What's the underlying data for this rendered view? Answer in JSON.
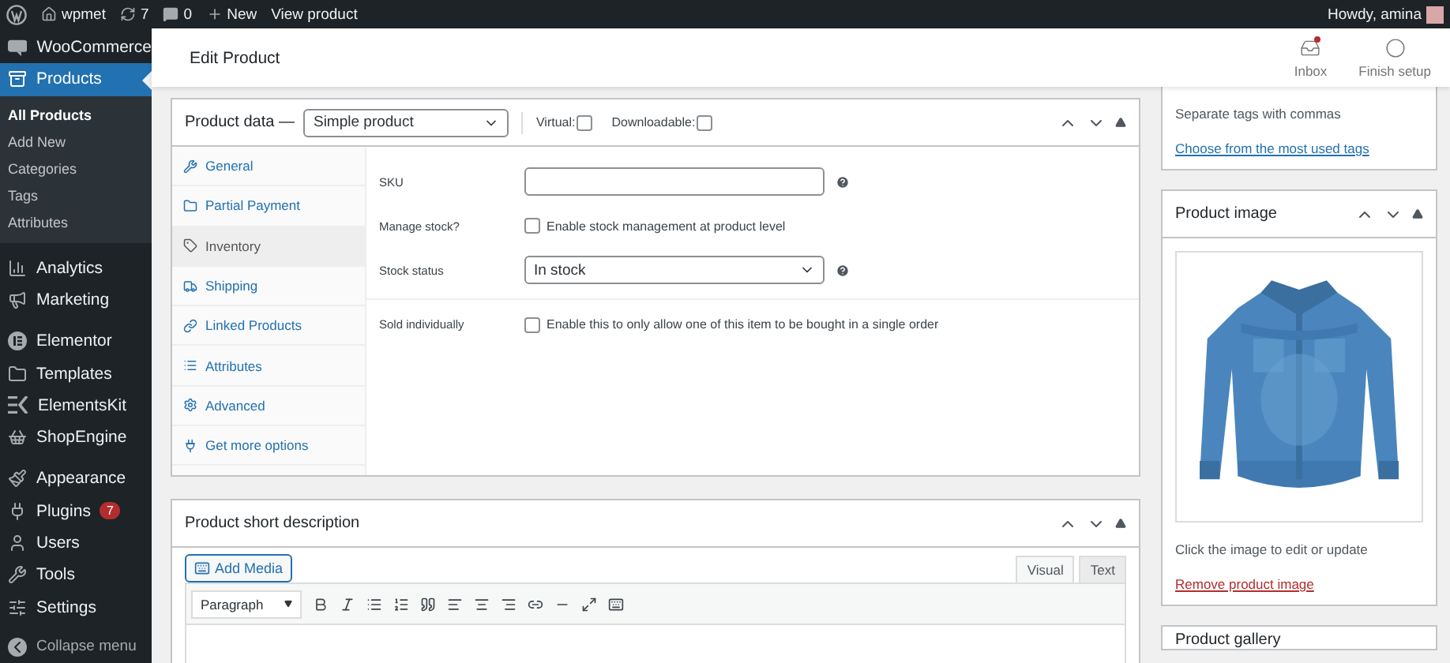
{
  "admin_bar": {
    "site": "wpmet",
    "updates": "7",
    "comments": "0",
    "new": "New",
    "view": "View product",
    "greeting": "Howdy, amina"
  },
  "sidebar": {
    "items": [
      {
        "label": "WooCommerce",
        "selected": false
      },
      {
        "label": "Products",
        "selected": true,
        "children": [
          {
            "label": "All Products",
            "selected": true
          },
          {
            "label": "Add New",
            "selected": false
          },
          {
            "label": "Categories",
            "selected": false
          },
          {
            "label": "Tags",
            "selected": false
          },
          {
            "label": "Attributes",
            "selected": false
          }
        ]
      },
      {
        "label": "Analytics",
        "selected": false
      },
      {
        "label": "Marketing",
        "selected": false
      },
      {
        "label": "Elementor",
        "selected": false
      },
      {
        "label": "Templates",
        "selected": false
      },
      {
        "label": "ElementsKit",
        "selected": false
      },
      {
        "label": "ShopEngine",
        "selected": false
      },
      {
        "label": "Appearance",
        "selected": false
      },
      {
        "label": "Plugins",
        "selected": false,
        "badge": "7"
      },
      {
        "label": "Users",
        "selected": false
      },
      {
        "label": "Tools",
        "selected": false
      },
      {
        "label": "Settings",
        "selected": false
      }
    ],
    "collapse": "Collapse menu"
  },
  "header": {
    "title": "Edit Product",
    "actions": [
      {
        "label": "Inbox",
        "unread": true
      },
      {
        "label": "Finish setup"
      }
    ]
  },
  "product_data": {
    "title": "Product data —",
    "type": "Simple product",
    "options": [
      {
        "label": "Virtual:",
        "checked": false
      },
      {
        "label": "Downloadable:",
        "checked": false
      }
    ],
    "tabs": [
      {
        "label": "General",
        "selected": false
      },
      {
        "label": "Partial Payment",
        "selected": false
      },
      {
        "label": "Inventory",
        "selected": true
      },
      {
        "label": "Shipping",
        "selected": false
      },
      {
        "label": "Linked Products",
        "selected": false
      },
      {
        "label": "Attributes",
        "selected": false
      },
      {
        "label": "Advanced",
        "selected": false
      },
      {
        "label": "Get more options",
        "selected": false
      }
    ],
    "fields": [
      {
        "kind": "text",
        "label": "SKU",
        "help": true
      },
      {
        "kind": "checkbox",
        "label": "Manage stock?",
        "text": "Enable stock management at product level",
        "checked": false
      },
      {
        "kind": "select",
        "label": "Stock status",
        "value": "In stock",
        "help": true
      },
      {
        "kind": "checkbox",
        "label": "Sold individually",
        "text": "Enable this to only allow one of this item to be bought in a single order",
        "checked": false
      }
    ]
  },
  "short_description": {
    "title": "Product short description",
    "add_media": "Add Media",
    "editor_tabs": [
      {
        "label": "Visual",
        "selected": true
      },
      {
        "label": "Text",
        "selected": false
      }
    ],
    "format": "Paragraph"
  },
  "tags": {
    "hint": "Separate tags with commas",
    "link": "Choose from the most used tags"
  },
  "product_image": {
    "title": "Product image",
    "caption": "Click the image to edit or update",
    "remove": "Remove product image"
  },
  "gallery": {
    "title": "Product gallery"
  }
}
